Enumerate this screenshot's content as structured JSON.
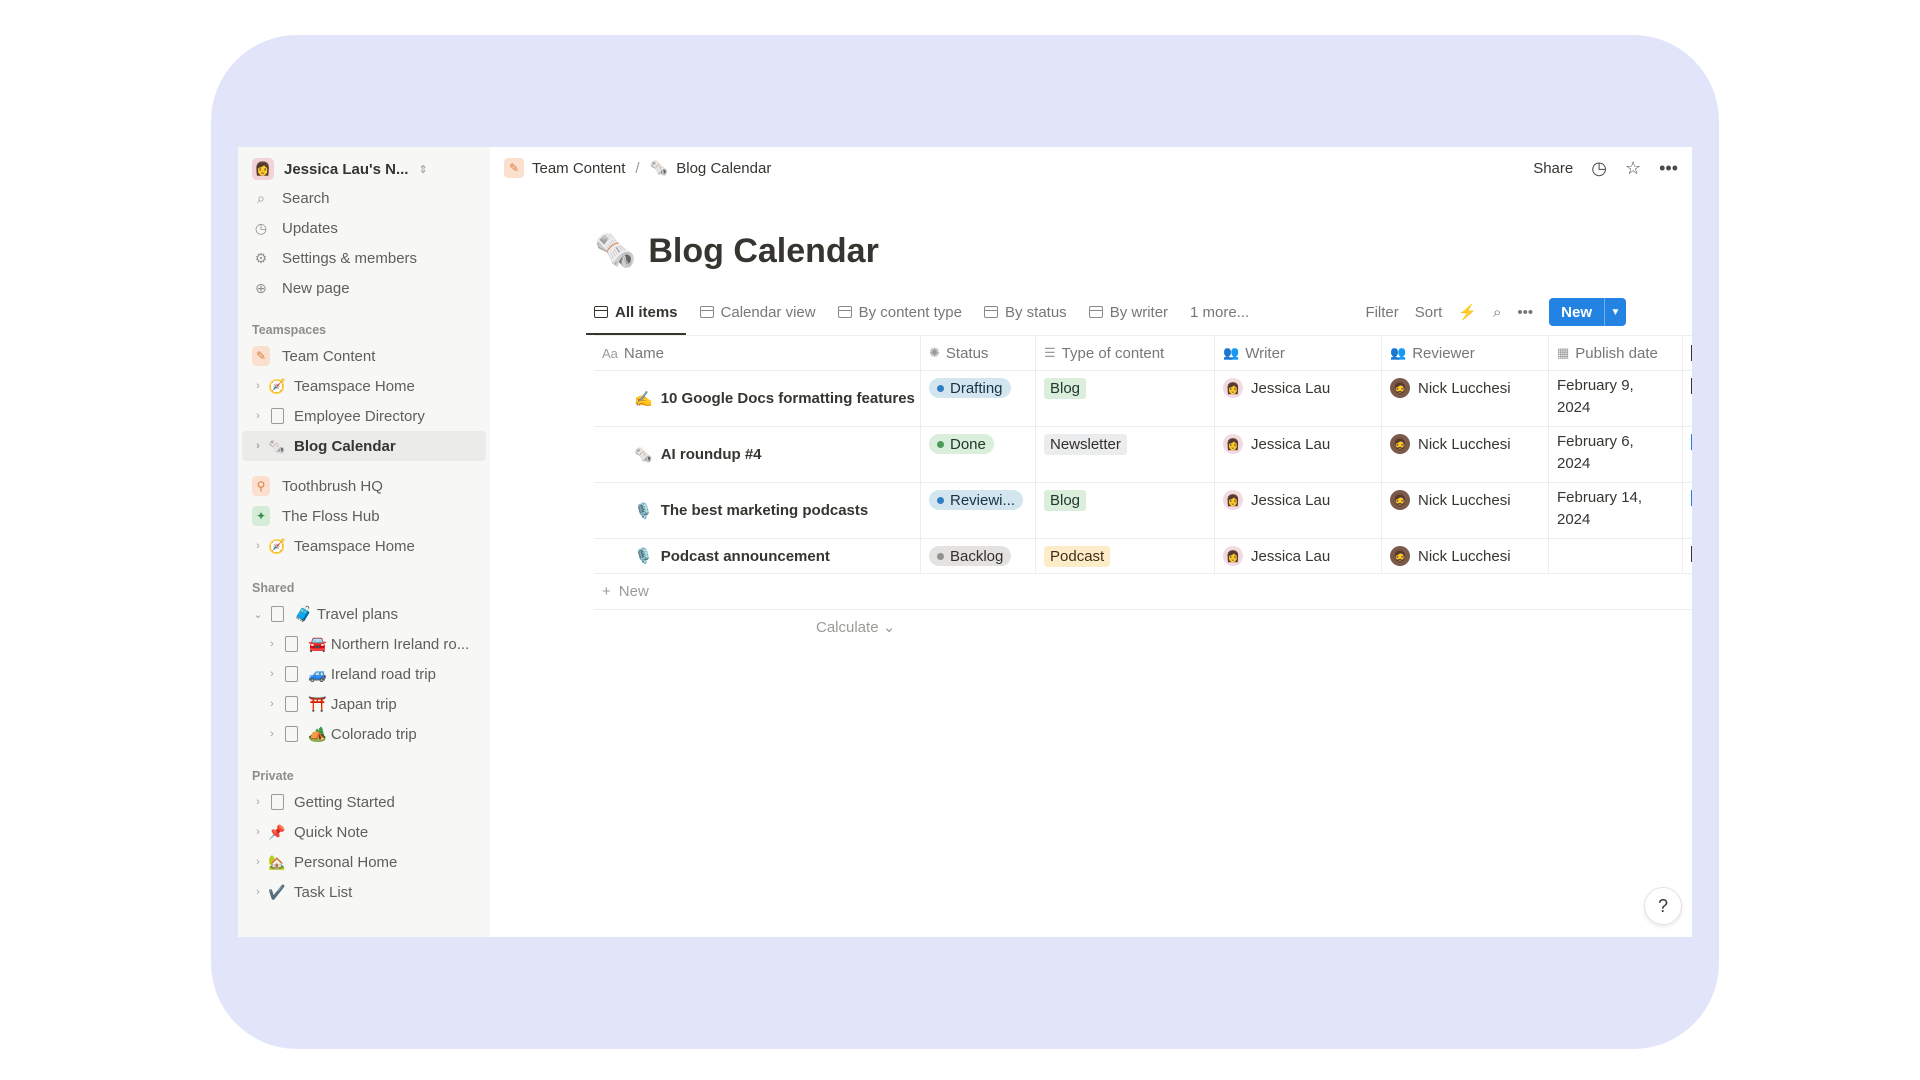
{
  "workspace": {
    "name": "Jessica Lau's N...",
    "avatar": "👩"
  },
  "sidebar": {
    "top_items": [
      {
        "label": "Search",
        "icon": "search-icon"
      },
      {
        "label": "Updates",
        "icon": "clock-icon"
      },
      {
        "label": "Settings & members",
        "icon": "gear-icon"
      },
      {
        "label": "New page",
        "icon": "plus-circle-icon"
      }
    ],
    "teamspaces_label": "Teamspaces",
    "teamspaces": [
      {
        "label": "Team Content"
      },
      {
        "label": "Teamspace Home"
      },
      {
        "label": "Employee Directory"
      },
      {
        "label": "Blog Calendar"
      },
      {
        "label": "Toothbrush HQ"
      },
      {
        "label": "The Floss Hub"
      },
      {
        "label": "Teamspace Home"
      }
    ],
    "shared_label": "Shared",
    "shared": [
      {
        "label": "Travel plans"
      },
      {
        "label": "Northern Ireland ro..."
      },
      {
        "label": "Ireland road trip"
      },
      {
        "label": "Japan trip"
      },
      {
        "label": "Colorado trip"
      }
    ],
    "private_label": "Private",
    "private": [
      {
        "label": "Getting Started"
      },
      {
        "label": "Quick Note"
      },
      {
        "label": "Personal Home"
      },
      {
        "label": "Task List"
      }
    ]
  },
  "breadcrumb": {
    "parent": "Team Content",
    "separator": "/",
    "current": "Blog Calendar"
  },
  "topbar": {
    "share": "Share"
  },
  "page": {
    "title": "Blog Calendar",
    "emoji": "🗞️"
  },
  "views": [
    "All items",
    "Calendar view",
    "By content type",
    "By status",
    "By writer",
    "1 more..."
  ],
  "actions": {
    "filter": "Filter",
    "sort": "Sort",
    "new": "New"
  },
  "table": {
    "headers": {
      "name": "Name",
      "name_prefix": "Aa",
      "status": "Status",
      "type": "Type of content",
      "writer": "Writer",
      "reviewer": "Reviewer",
      "publish": "Publish date"
    },
    "rows": [
      {
        "name": "10 Google Docs formatting features",
        "status": "Drafting",
        "type": "Blog",
        "writer": "Jessica Lau",
        "reviewer": "Nick Lucchesi",
        "date_line1": "February 9,",
        "date_line2": "2024"
      },
      {
        "name": "AI roundup #4",
        "status": "Done",
        "type": "Newsletter",
        "writer": "Jessica Lau",
        "reviewer": "Nick Lucchesi",
        "date_line1": "February 6,",
        "date_line2": "2024"
      },
      {
        "name": "The best marketing podcasts",
        "status": "Reviewi...",
        "type": "Blog",
        "writer": "Jessica Lau",
        "reviewer": "Nick Lucchesi",
        "date_line1": "February 14,",
        "date_line2": "2024"
      },
      {
        "name": "Podcast announcement",
        "status": "Backlog",
        "type": "Podcast",
        "writer": "Jessica Lau",
        "reviewer": "Nick Lucchesi",
        "date_line1": "",
        "date_line2": ""
      }
    ],
    "new_row": "New",
    "calculate": "Calculate"
  },
  "help": "?",
  "colors": {
    "accent": "#2383e2",
    "frame": "#e2e5fa",
    "sidebar": "#f7f7f5"
  }
}
